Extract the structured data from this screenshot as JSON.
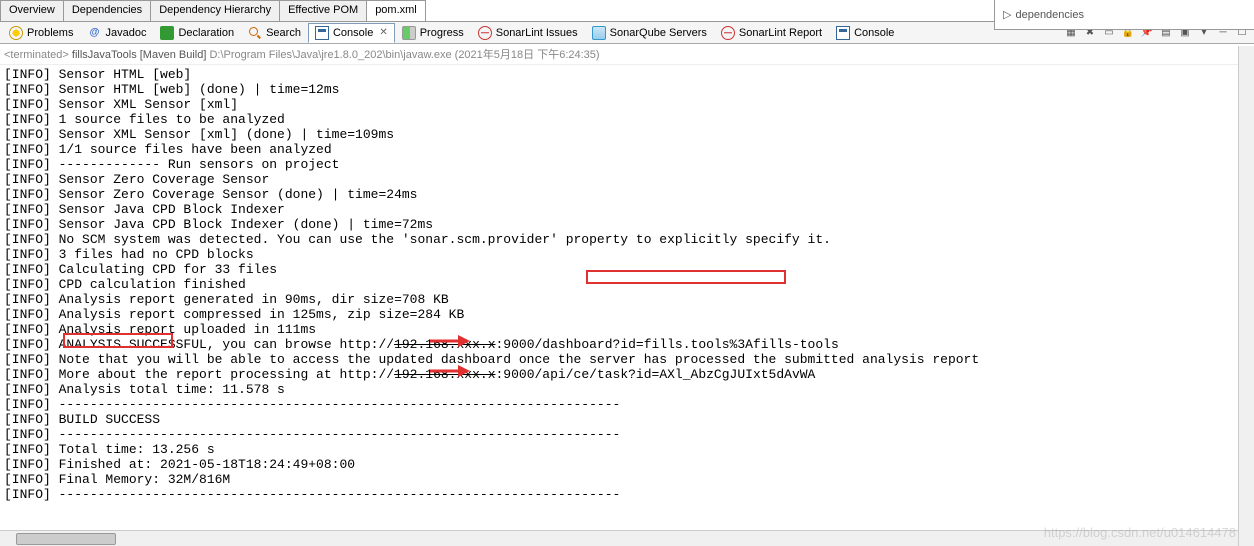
{
  "top_tabs": [
    "Overview",
    "Dependencies",
    "Dependency Hierarchy",
    "Effective POM",
    "pom.xml"
  ],
  "top_tabs_active": 4,
  "right_panel_text": "dependencies",
  "views": [
    {
      "label": "Problems",
      "icon": "problems"
    },
    {
      "label": "Javadoc",
      "icon": "javadoc"
    },
    {
      "label": "Declaration",
      "icon": "decl"
    },
    {
      "label": "Search",
      "icon": "search"
    },
    {
      "label": "Console",
      "icon": "console",
      "active": true,
      "closable": true
    },
    {
      "label": "Progress",
      "icon": "progress"
    },
    {
      "label": "SonarLint Issues",
      "icon": "sonar"
    },
    {
      "label": "SonarQube Servers",
      "icon": "sonarq"
    },
    {
      "label": "SonarLint Report",
      "icon": "sonar"
    },
    {
      "label": "Console",
      "icon": "console"
    }
  ],
  "terminated": {
    "prefix": "<terminated>",
    "run": "fillsJavaTools [Maven Build]",
    "path": "D:\\Program Files\\Java\\jre1.8.0_202\\bin\\javaw.exe",
    "time": "(2021年5月18日 下午6:24:35)"
  },
  "console_lines": [
    "[INFO] Sensor HTML [web]",
    "[INFO] Sensor HTML [web] (done) | time=12ms",
    "[INFO] Sensor XML Sensor [xml]",
    "[INFO] 1 source files to be analyzed",
    "[INFO] Sensor XML Sensor [xml] (done) | time=109ms",
    "[INFO] 1/1 source files have been analyzed",
    "[INFO] ------------- Run sensors on project",
    "[INFO] Sensor Zero Coverage Sensor",
    "[INFO] Sensor Zero Coverage Sensor (done) | time=24ms",
    "[INFO] Sensor Java CPD Block Indexer",
    "[INFO] Sensor Java CPD Block Indexer (done) | time=72ms",
    "[INFO] No SCM system was detected. You can use the 'sonar.scm.provider' property to explicitly specify it.",
    "[INFO] 3 files had no CPD blocks",
    "[INFO] Calculating CPD for 33 files",
    "[INFO] CPD calculation finished",
    "[INFO] Analysis report generated in 90ms, dir size=708 KB",
    "[INFO] Analysis report compressed in 125ms, zip size=284 KB",
    "[INFO] Analysis report uploaded in 111ms",
    "[INFO] ANALYSIS SUCCESSFUL, you can browse http://192.168.xxx.x:9000/dashboard?id=fills.tools%3Afills-tools",
    "[INFO] Note that you will be able to access the updated dashboard once the server has processed the submitted analysis report",
    "[INFO] More about the report processing at http://192.168.xxx.x:9000/api/ce/task?id=AXl_AbzCgJUIxt5dAvWA",
    "[INFO] Analysis total time: 11.578 s",
    "[INFO] ------------------------------------------------------------------------",
    "[INFO] BUILD SUCCESS",
    "[INFO] ------------------------------------------------------------------------",
    "[INFO] Total time: 13.256 s",
    "[INFO] Finished at: 2021-05-18T18:24:49+08:00",
    "[INFO] Final Memory: 32M/816M",
    "[INFO] ------------------------------------------------------------------------"
  ],
  "watermark": "https://blog.csdn.net/u014614478"
}
